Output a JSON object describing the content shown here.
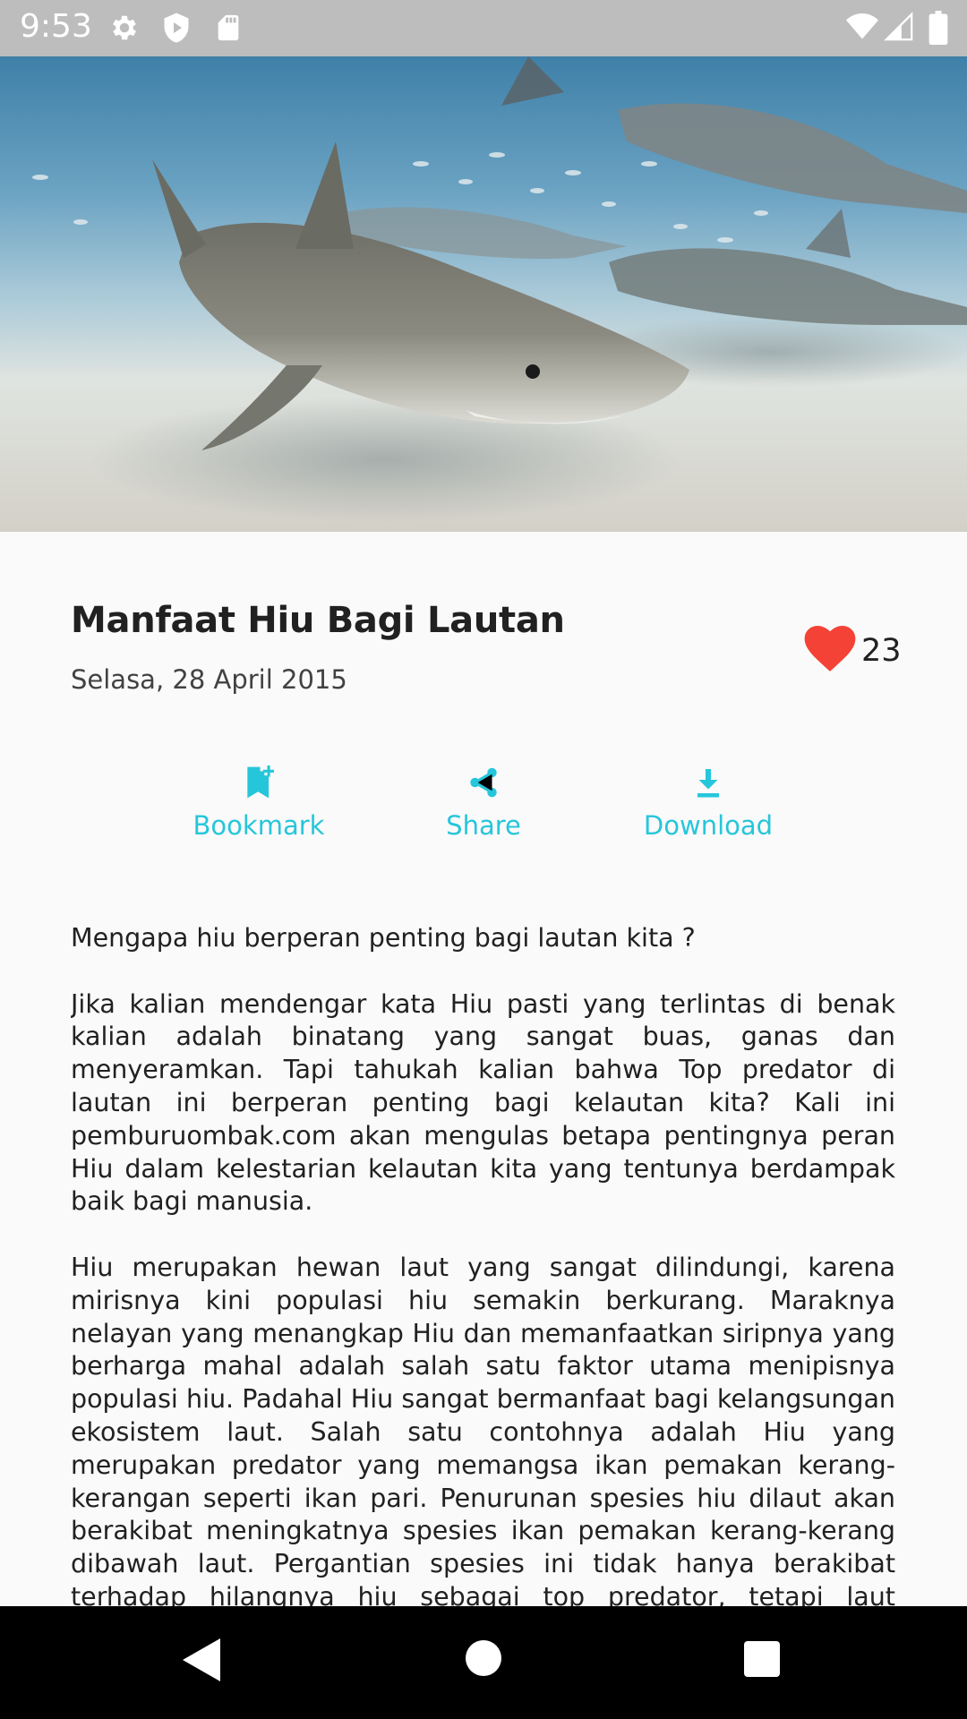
{
  "status_bar": {
    "time": "9:53",
    "left_icons": [
      "gear-icon",
      "shield-icon",
      "sd-card-icon"
    ],
    "right_icons": [
      "wifi-icon",
      "signal-icon",
      "battery-icon"
    ]
  },
  "hero": {
    "image": "tiger-shark-underwater-photo"
  },
  "article": {
    "title": "Manfaat Hiu Bagi Lautan",
    "date": "Selasa, 28 April 2015",
    "likes": "23",
    "actions": [
      {
        "label": "Bookmark",
        "icon": "bookmark-add-icon"
      },
      {
        "label": "Share",
        "icon": "share-icon"
      },
      {
        "label": "Download",
        "icon": "download-icon"
      }
    ],
    "paragraphs": [
      "Mengapa hiu berperan penting bagi lautan kita ?",
      "Jika kalian mendengar kata Hiu pasti yang terlintas di benak kalian adalah binatang yang sangat buas, ganas dan menyeramkan. Tapi tahukah kalian bahwa Top predator di lautan ini berperan penting bagi kelautan kita? Kali ini pemburuombak.com akan mengulas betapa pentingnya peran Hiu dalam kelestarian kelautan kita yang tentunya berdampak baik bagi manusia.",
      "Hiu merupakan hewan laut yang sangat dilindungi, karena mirisnya kini populasi hiu semakin berkurang. Maraknya nelayan yang menangkap Hiu dan memanfaatkan siripnya yang berharga mahal adalah salah satu faktor utama menipisnya populasi hiu. Padahal Hiu sangat bermanfaat bagi kelangsungan ekosistem laut. Salah satu contohnya adalah Hiu yang merupakan predator yang memangsa ikan pemakan kerang-kerangan seperti ikan pari. Penurunan spesies hiu dilaut akan berakibat meningkatnya spesies ikan pemakan kerang-kerang dibawah laut. Pergantian spesies ini tidak hanya berakibat terhadap hilangnya hiu sebagai top predator, tetapi laut sebagai habitat juga akan berubah."
    ]
  },
  "colors": {
    "accent": "#26c6da",
    "heart": "#f44336",
    "status_bar": "#bdbdbd",
    "nav_bar": "#000000"
  },
  "nav_bar": {
    "buttons": [
      "back-icon",
      "home-icon",
      "recents-icon"
    ]
  }
}
